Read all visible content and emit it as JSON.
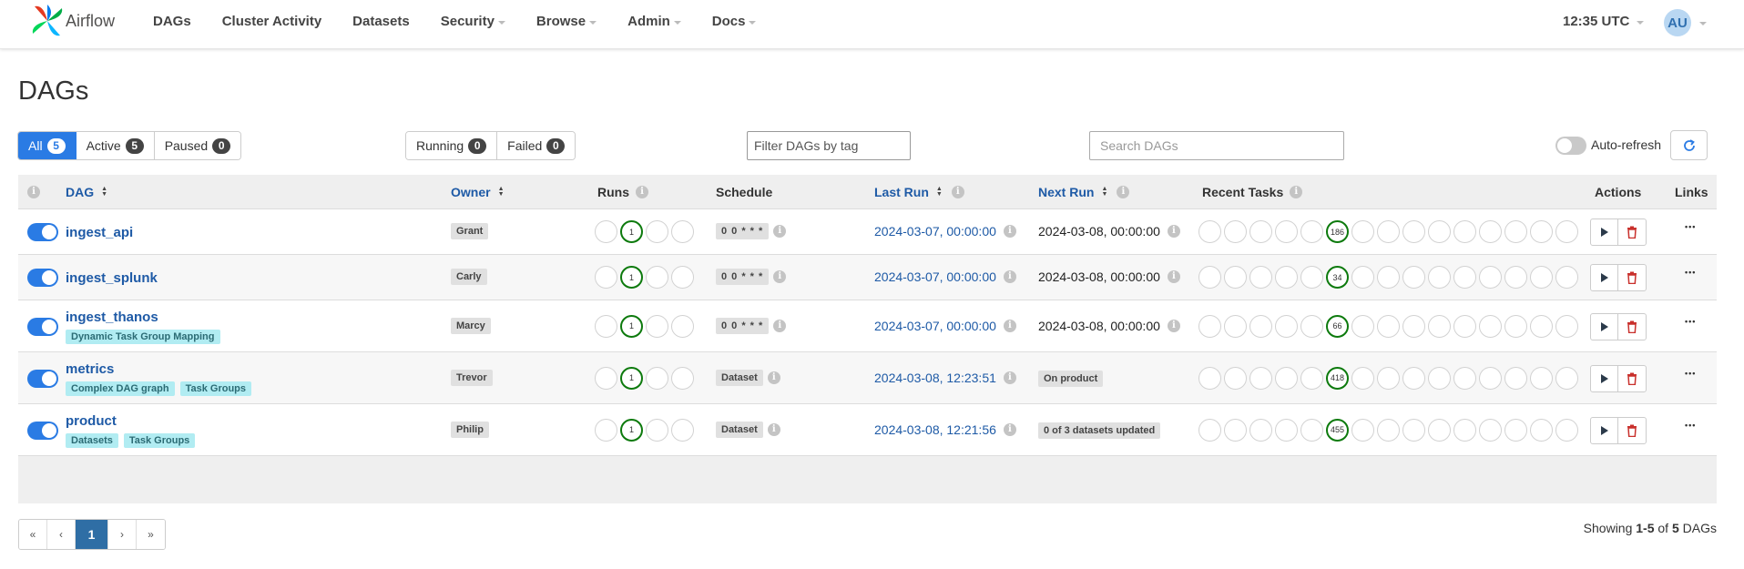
{
  "nav": {
    "brand": "Airflow",
    "items": [
      {
        "label": "DAGs",
        "caret": false
      },
      {
        "label": "Cluster Activity",
        "caret": false
      },
      {
        "label": "Datasets",
        "caret": false
      },
      {
        "label": "Security",
        "caret": true
      },
      {
        "label": "Browse",
        "caret": true
      },
      {
        "label": "Admin",
        "caret": true
      },
      {
        "label": "Docs",
        "caret": true
      }
    ],
    "time": "12:35 UTC",
    "user_initials": "AU"
  },
  "page_title": "DAGs",
  "status_filters": [
    {
      "label": "All",
      "count": "5",
      "active": true
    },
    {
      "label": "Active",
      "count": "5",
      "active": false
    },
    {
      "label": "Paused",
      "count": "0",
      "active": false
    }
  ],
  "state_filters": [
    {
      "label": "Running",
      "count": "0"
    },
    {
      "label": "Failed",
      "count": "0"
    }
  ],
  "tag_filter_placeholder": "Filter DAGs by tag",
  "search_placeholder": "Search DAGs",
  "auto_refresh_label": "Auto-refresh",
  "columns": {
    "info": "i",
    "dag": "DAG",
    "owner": "Owner",
    "runs": "Runs",
    "schedule": "Schedule",
    "last_run": "Last Run",
    "next_run": "Next Run",
    "recent_tasks": "Recent Tasks",
    "actions": "Actions",
    "links": "Links"
  },
  "dags": [
    {
      "name": "ingest_api",
      "tags": [],
      "owner": "Grant",
      "run_count": "1",
      "schedule": "0 0 * * *",
      "last_run": "2024-03-07, 00:00:00",
      "next_run": "2024-03-08, 00:00:00",
      "next_run_badge": "",
      "task_count": "186"
    },
    {
      "name": "ingest_splunk",
      "tags": [],
      "owner": "Carly",
      "run_count": "1",
      "schedule": "0 0 * * *",
      "last_run": "2024-03-07, 00:00:00",
      "next_run": "2024-03-08, 00:00:00",
      "next_run_badge": "",
      "task_count": "34"
    },
    {
      "name": "ingest_thanos",
      "tags": [
        "Dynamic Task Group Mapping"
      ],
      "owner": "Marcy",
      "run_count": "1",
      "schedule": "0 0 * * *",
      "last_run": "2024-03-07, 00:00:00",
      "next_run": "2024-03-08, 00:00:00",
      "next_run_badge": "",
      "task_count": "66"
    },
    {
      "name": "metrics",
      "tags": [
        "Complex DAG graph",
        "Task Groups"
      ],
      "owner": "Trevor",
      "run_count": "1",
      "schedule": "Dataset",
      "last_run": "2024-03-08, 12:23:51",
      "next_run": "",
      "next_run_badge": "On product",
      "task_count": "418"
    },
    {
      "name": "product",
      "tags": [
        "Datasets",
        "Task Groups"
      ],
      "owner": "Philip",
      "run_count": "1",
      "schedule": "Dataset",
      "last_run": "2024-03-08, 12:21:56",
      "next_run": "",
      "next_run_badge": "0 of 3 datasets updated",
      "task_count": "455"
    }
  ],
  "pagination": {
    "first": "«",
    "prev": "‹",
    "current": "1",
    "next": "›",
    "last": "»"
  },
  "showing": {
    "prefix": "Showing ",
    "range": "1-5",
    "middle": " of ",
    "total": "5",
    "suffix": " DAGs"
  },
  "colors": {
    "accent": "#2a7be4",
    "link": "#1e5aa6",
    "success": "#0d7a0d",
    "danger": "#c9302c",
    "tag_bg": "#b1ecf2"
  },
  "icons": {
    "logo": "airflow-pinwheel-icon",
    "refresh": "refresh-icon",
    "trigger": "play-icon",
    "delete": "trash-icon",
    "more": "ellipsis-icon"
  }
}
